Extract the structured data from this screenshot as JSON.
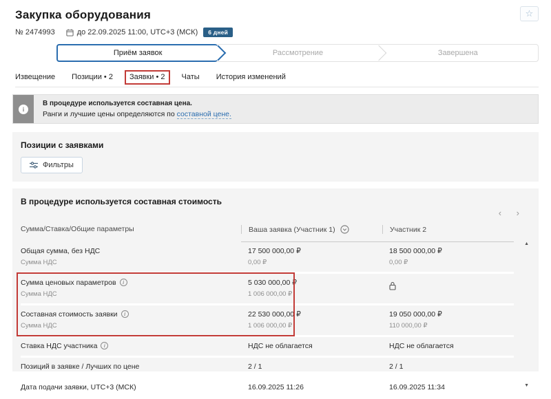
{
  "header": {
    "title": "Закупка оборудования",
    "number": "№ 2474993",
    "deadline": "до 22.09.2025 11:00, UTC+3 (МСК)",
    "days_badge": "6 дней"
  },
  "stepper": {
    "steps": [
      {
        "label": "Приём заявок",
        "state": "active"
      },
      {
        "label": "Рассмотрение",
        "state": "pending"
      },
      {
        "label": "Завершена",
        "state": "pending"
      }
    ]
  },
  "tabs": [
    {
      "label": "Извещение"
    },
    {
      "label": "Позиции • 2"
    },
    {
      "label": "Заявки • 2",
      "highlighted": true
    },
    {
      "label": "Чаты"
    },
    {
      "label": "История изменений"
    }
  ],
  "banner": {
    "line1": "В процедуре используется составная цена.",
    "line2_prefix": "Ранги и лучшие цены определяются по ",
    "line2_link": "составной цене."
  },
  "positions": {
    "title": "Позиции с заявками",
    "filter_label": "Фильтры"
  },
  "table": {
    "title": "В процедуре используется составная стоимость",
    "columns": {
      "c1": "Сумма/Ставка/Общие параметры",
      "c2": "Ваша заявка (Участник 1)",
      "c3": "Участник 2"
    },
    "rows": {
      "0": {
        "label": "Общая сумма, без НДС",
        "sub": "Сумма НДС",
        "v1": "17 500 000,00 ₽",
        "v1sub": "0,00 ₽",
        "v2": "18 500 000,00 ₽",
        "v2sub": "0,00 ₽"
      },
      "1": {
        "label": "Сумма ценовых параметров",
        "sub": "Сумма НДС",
        "v1": "5 030 000,00 ₽",
        "v1sub": "1 006 000,00 ₽",
        "v2_locked": "lock-icon"
      },
      "2": {
        "label": "Составная стоимость заявки",
        "sub": "Сумма НДС",
        "v1": "22 530 000,00 ₽",
        "v1sub": "1 006 000,00 ₽",
        "v2": "19 050 000,00 ₽",
        "v2sub": "110 000,00 ₽"
      },
      "3": {
        "label": "Ставка НДС участника",
        "v1": "НДС не облагается",
        "v2": "НДС не облагается"
      },
      "4": {
        "label": "Позиций в заявке / Лучших по цене",
        "v1": "2 / 1",
        "v2": "2 / 1"
      },
      "5": {
        "label": "Дата подачи заявки, UTC+3 (МСК)",
        "v1": "16.09.2025 11:26",
        "v2": "16.09.2025 11:34"
      }
    }
  },
  "icons": {
    "favorite": "☆",
    "info": "i",
    "pager_prev": "‹",
    "pager_next": "›",
    "scroll_up": "▲",
    "scroll_down": "▼"
  },
  "colors": {
    "accent_blue": "#2a6daf",
    "badge_bg": "#2a5f87",
    "annotation_red": "#c23a36",
    "panel_bg": "#f4f4f4",
    "banner_bg": "#ececec",
    "banner_icon_bg": "#8e8e8e",
    "link": "#2a6daf"
  }
}
